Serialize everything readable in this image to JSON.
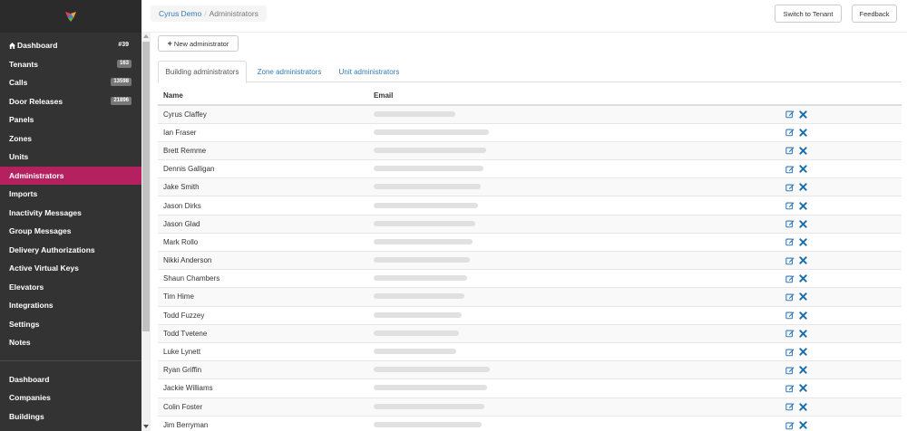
{
  "colors": {
    "sidebar_bg": "#333333",
    "active_bg": "#b5215f",
    "link": "#337ab7",
    "edit_icon": "#337ab7",
    "delete_icon": "#1a6fb0"
  },
  "sidebar": {
    "logo_icon": "brand-logo-icon",
    "items": [
      {
        "label": "Dashboard",
        "icon": "home-icon",
        "badge": "#39",
        "badge_style": "plain"
      },
      {
        "label": "Tenants",
        "badge": "163"
      },
      {
        "label": "Calls",
        "badge": "13598"
      },
      {
        "label": "Door Releases",
        "badge": "21896"
      },
      {
        "label": "Panels"
      },
      {
        "label": "Zones"
      },
      {
        "label": "Units"
      },
      {
        "label": "Administrators",
        "active": true
      },
      {
        "label": "Imports"
      },
      {
        "label": "Inactivity Messages"
      },
      {
        "label": "Group Messages"
      },
      {
        "label": "Delivery Authorizations"
      },
      {
        "label": "Active Virtual Keys"
      },
      {
        "label": "Elevators"
      },
      {
        "label": "Integrations"
      },
      {
        "label": "Settings"
      },
      {
        "label": "Notes"
      }
    ],
    "secondary_items": [
      {
        "label": "Dashboard"
      },
      {
        "label": "Companies"
      },
      {
        "label": "Buildings"
      }
    ]
  },
  "header": {
    "breadcrumb": {
      "parent": "Cyrus Demo",
      "separator": "/",
      "current": "Administrators"
    },
    "switch_button": "Switch to Tenant",
    "feedback_button": "Feedback"
  },
  "main": {
    "new_button": "New administrator",
    "tabs": [
      {
        "label": "Building administrators",
        "active": true
      },
      {
        "label": "Zone administrators"
      },
      {
        "label": "Unit administrators"
      }
    ],
    "table": {
      "columns": [
        "Name",
        "Email"
      ],
      "rows": [
        "Cyrus Claffey",
        "Ian Fraser",
        "Brett Remme",
        "Dennis Galligan",
        "Jake Smith",
        "Jason Dirks",
        "Jason Glad",
        "Mark Rollo",
        "Nikki Anderson",
        "Shaun Chambers",
        "Tim Hime",
        "Todd Fuzzey",
        "Todd Tvetene",
        "Luke Lynett",
        "Ryan Griffin",
        "Jackie Williams",
        "Colin Foster",
        "Jim Berryman"
      ]
    }
  }
}
